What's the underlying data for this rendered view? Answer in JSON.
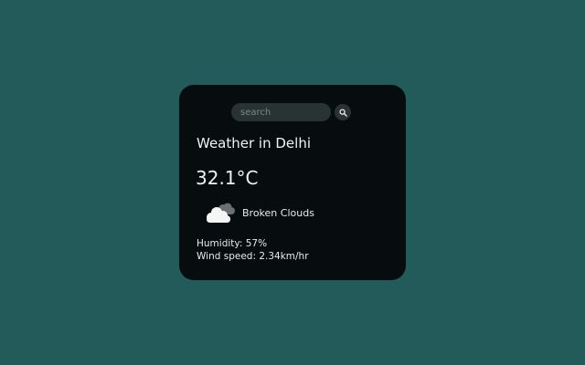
{
  "search": {
    "placeholder": "search",
    "button_icon": "search-icon"
  },
  "weather": {
    "city_title": "Weather in Delhi",
    "temperature": "32.1°C",
    "condition_icon": "broken-clouds-icon",
    "description": "Broken Clouds",
    "humidity": "Humidity: 57%",
    "wind_speed": "Wind speed: 2.34km/hr"
  },
  "colors": {
    "page_background": "#235b5a",
    "card_background": "#070c0f",
    "input_background": "#2a3334",
    "text": "#e9eceb"
  }
}
